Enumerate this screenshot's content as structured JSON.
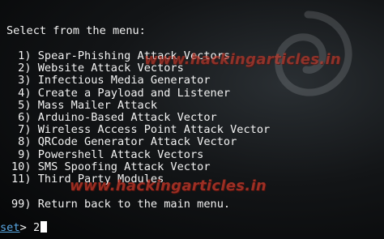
{
  "terminal": {
    "header": "Select from the menu:",
    "menu_items": [
      {
        "num": " 1)",
        "label": "Spear-Phishing Attack Vectors"
      },
      {
        "num": " 2)",
        "label": "Website Attack Vectors"
      },
      {
        "num": " 3)",
        "label": "Infectious Media Generator"
      },
      {
        "num": " 4)",
        "label": "Create a Payload and Listener"
      },
      {
        "num": " 5)",
        "label": "Mass Mailer Attack"
      },
      {
        "num": " 6)",
        "label": "Arduino-Based Attack Vector"
      },
      {
        "num": " 7)",
        "label": "Wireless Access Point Attack Vector"
      },
      {
        "num": " 8)",
        "label": "QRCode Generator Attack Vector"
      },
      {
        "num": " 9)",
        "label": "Powershell Attack Vectors"
      },
      {
        "num": "10)",
        "label": "SMS Spoofing Attack Vector"
      },
      {
        "num": "11)",
        "label": "Third Party Modules"
      }
    ],
    "return_item": {
      "num": "99)",
      "label": "Return back to the main menu."
    },
    "prompt": {
      "name": "set",
      "symbol": "> ",
      "input": "2"
    }
  },
  "watermarks": [
    "www.hackingarticles.in",
    "www.hackingarticles.in"
  ],
  "colors": {
    "background": "#131517",
    "text": "#f2f2f2",
    "prompt": "#5aa9e6",
    "watermark": "#d23a2a"
  }
}
